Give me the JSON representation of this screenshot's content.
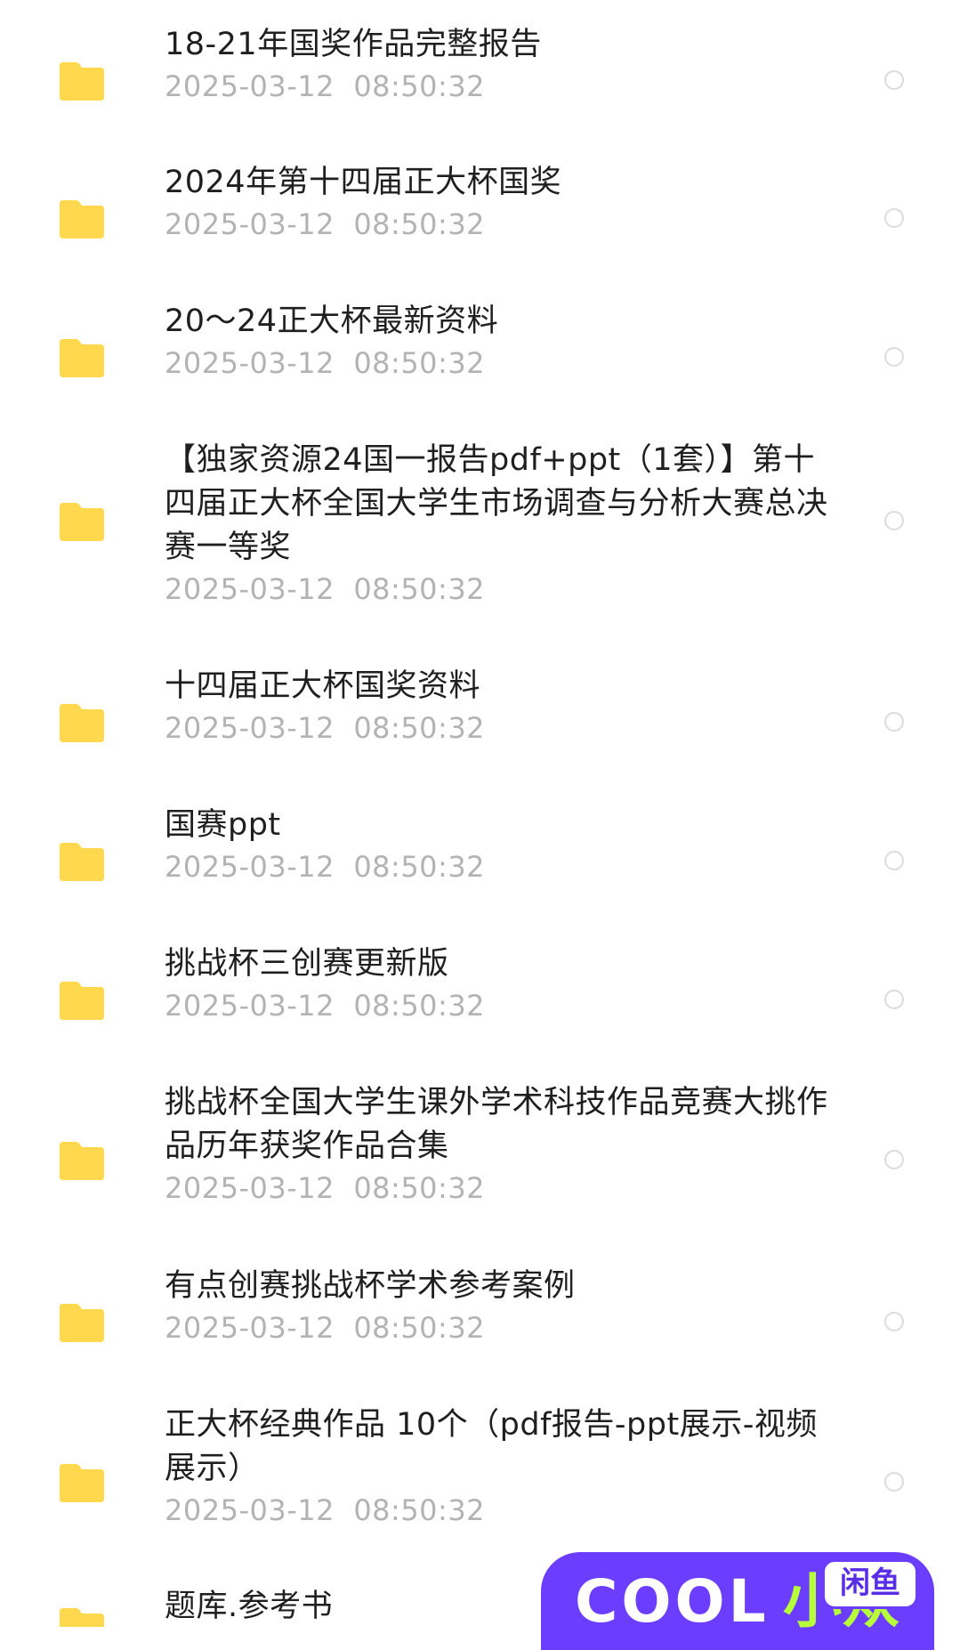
{
  "items": [
    {
      "title": "18-21年国奖作品完整报告",
      "date": "2025-03-12  08:50:32"
    },
    {
      "title": "2024年第十四届正大杯国奖",
      "date": "2025-03-12  08:50:32"
    },
    {
      "title": "20～24正大杯最新资料",
      "date": "2025-03-12  08:50:32"
    },
    {
      "title": "【独家资源24国一报告pdf+ppt（1套）】第十四届正大杯全国大学生市场调查与分析大赛总决赛一等奖",
      "date": "2025-03-12  08:50:32"
    },
    {
      "title": "十四届正大杯国奖资料",
      "date": "2025-03-12  08:50:32"
    },
    {
      "title": "国赛ppt",
      "date": "2025-03-12  08:50:32"
    },
    {
      "title": "挑战杯三创赛更新版",
      "date": "2025-03-12  08:50:32"
    },
    {
      "title": "挑战杯全国大学生课外学术科技作品竞赛大挑作品历年获奖作品合集",
      "date": "2025-03-12  08:50:32"
    },
    {
      "title": "有点创赛挑战杯学术参考案例",
      "date": "2025-03-12  08:50:32"
    },
    {
      "title": "正大杯经典作品 10个（pdf报告-ppt展示-视频展示）",
      "date": "2025-03-12  08:50:32"
    },
    {
      "title": "题库.参考书",
      "date": ""
    }
  ],
  "overlay": {
    "brand_text": "COOL",
    "brand_cn": "小众",
    "tag": "闲鱼"
  },
  "colors": {
    "folder": "#FFD84D",
    "title": "#1F1F1F",
    "date": "#B3B3B3",
    "radio_border": "#DCDCDC",
    "badge_bg": "#6B3DFF"
  },
  "icons": {
    "folder": "folder-icon",
    "select": "radio-circle"
  }
}
